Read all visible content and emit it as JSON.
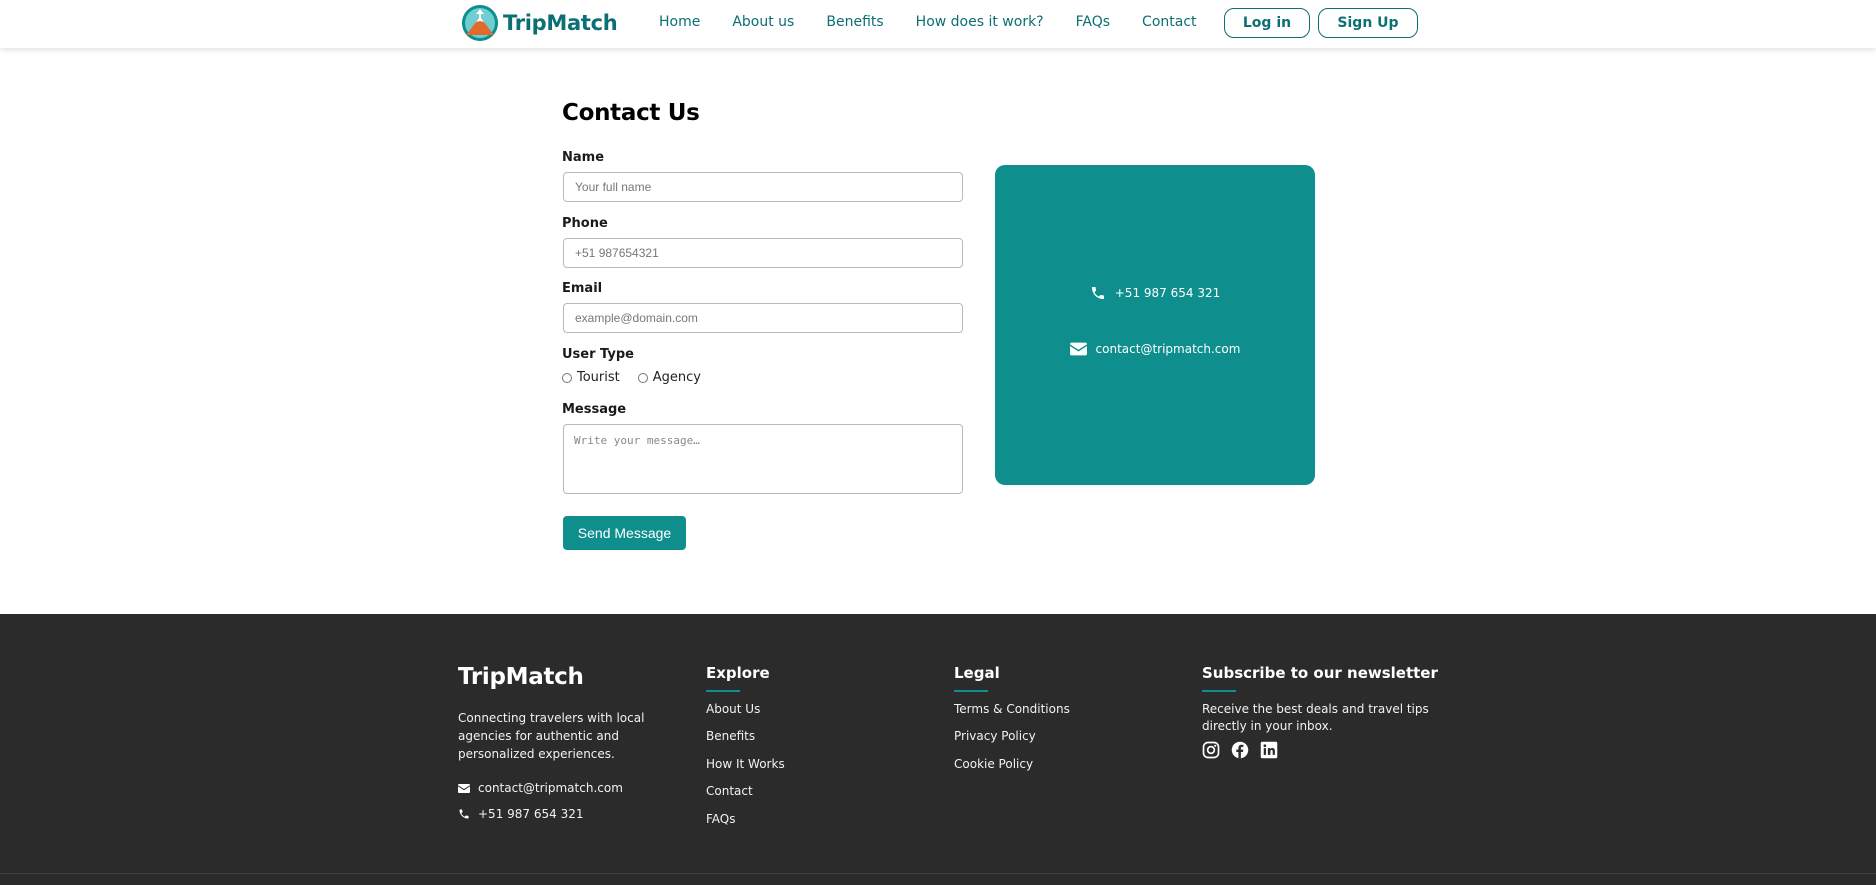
{
  "brand": {
    "name": "TripMatch",
    "color": "#0b6f73",
    "accent": "#0e8f8e"
  },
  "nav": {
    "items": [
      "Home",
      "About us",
      "Benefits",
      "How does it work?",
      "FAQs",
      "Contact"
    ],
    "login_label": "Log in",
    "signup_label": "Sign Up"
  },
  "contact_form": {
    "title": "Contact Us",
    "name_label": "Name",
    "name_placeholder": "Your full name",
    "phone_label": "Phone",
    "phone_placeholder": "+51 987654321",
    "email_label": "Email",
    "email_placeholder": "example@domain.com",
    "user_type_label": "User Type",
    "user_type_options": [
      "Tourist",
      "Agency"
    ],
    "message_label": "Message",
    "message_placeholder": "Write your message…",
    "send_label": "Send Message"
  },
  "info_card": {
    "phone": "+51 987 654 321",
    "phone_icon": "phone-icon",
    "email": "contact@tripmatch.com",
    "email_icon": "envelope-icon"
  },
  "footer": {
    "brand": "TripMatch",
    "description": "Connecting travelers with local agencies for authentic and personalized experiences.",
    "email": "contact@tripmatch.com",
    "phone": "+51 987 654 321",
    "explore": {
      "title": "Explore",
      "links": [
        "About Us",
        "Benefits",
        "How It Works",
        "Contact",
        "FAQs"
      ]
    },
    "legal": {
      "title": "Legal",
      "links": [
        "Terms & Conditions",
        "Privacy Policy",
        "Cookie Policy"
      ]
    },
    "newsletter": {
      "title": "Subscribe to our newsletter",
      "text": "Receive the best deals and travel tips directly in your inbox.",
      "social_icons": [
        "instagram-icon",
        "facebook-icon",
        "linkedin-icon"
      ]
    }
  }
}
